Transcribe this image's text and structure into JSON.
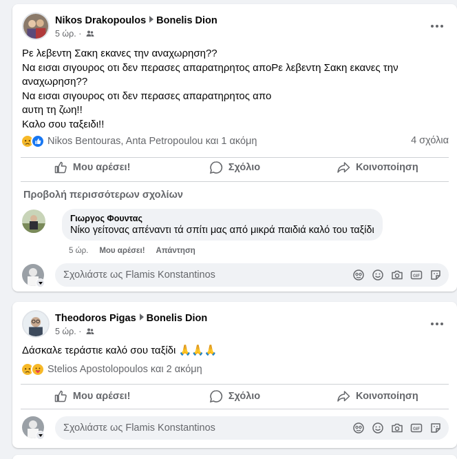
{
  "posts": [
    {
      "author": "Nikos Drakopoulos",
      "target": "Bonelis Dion",
      "time": "5 ώρ.",
      "text_lines": [
        "Ρε λεβεντη Σακη εκανες την αναχωρηση??",
        "Να εισαι σιγουρος οτι δεν περασες απαρατηρητος αποΡε λεβεντη Σακη εκανες την",
        "αναχωρηση??",
        "Να εισαι σιγουρος οτι δεν περασες απαρατηρητος απο",
        "αυτη τη ζωη!!",
        "Καλο σου ταξειδι!!"
      ],
      "reactions_text": "Nikos Bentouras, Anta Petropoulou και 1 ακόμη",
      "comments_count": "4 σχόλια",
      "more_comments_label": "Προβολή περισσότερων σχολίων",
      "comment": {
        "author": "Γιωργος Φουντας",
        "text": "Νίκο γείτονας απέναντι τά σπίτι μας από μικρά παιδιά καλό του ταξίδι",
        "time": "5 ώρ.",
        "like_label": "Μου αρέσει!",
        "reply_label": "Απάντηση"
      },
      "composer_placeholder": "Σχολιάστε ως Flamis Konstantinos"
    },
    {
      "author": "Theodoros Pigas",
      "target": "Bonelis Dion",
      "time": "5 ώρ.",
      "text": "Δάσκαλε τεράστιε καλό σου ταξίδι 🙏🙏🙏",
      "reactions_text": "Stelios Apostolopoulos και 2 ακόμη",
      "composer_placeholder": "Σχολιάστε ως Flamis Konstantinos"
    }
  ],
  "actions": {
    "like": "Μου αρέσει!",
    "comment": "Σχόλιο",
    "share": "Κοινοποίηση"
  },
  "icons": {
    "audience": "friends-icon",
    "more": "more-options-icon",
    "reaction_1": "sad-reaction-icon",
    "reaction_2": "like-reaction-icon",
    "reaction_3": "care-reaction-icon",
    "composer": [
      "avatar-sticker-icon",
      "emoji-icon",
      "camera-icon",
      "gif-icon",
      "sticker-icon"
    ]
  },
  "colors": {
    "like_blue": "#1877f2",
    "reaction_yellow": "#f7b928",
    "secondary_text": "#65676b"
  }
}
